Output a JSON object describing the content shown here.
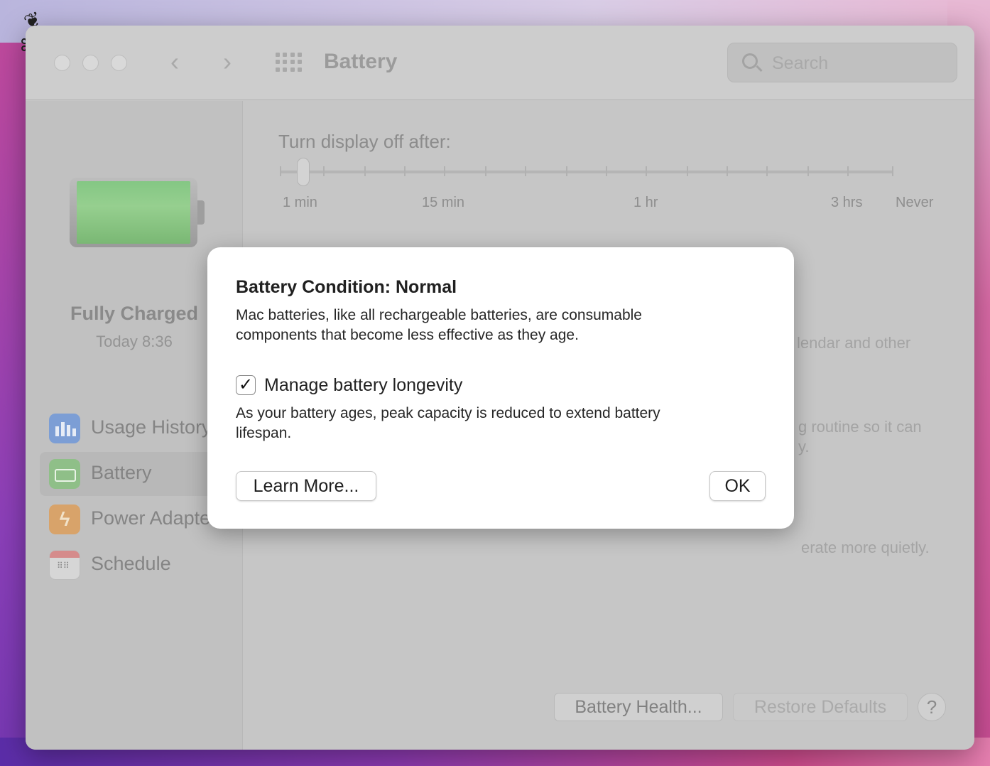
{
  "window": {
    "title": "Battery",
    "search_placeholder": "Search"
  },
  "sidebar": {
    "status": "Fully Charged",
    "time": "Today 8:36",
    "items": [
      {
        "label": "Usage History",
        "icon": "usage-history-icon"
      },
      {
        "label": "Battery",
        "icon": "battery-icon",
        "selected": true
      },
      {
        "label": "Power Adapter",
        "icon": "power-adapter-icon"
      },
      {
        "label": "Schedule",
        "icon": "schedule-icon"
      }
    ]
  },
  "content": {
    "slider_label": "Turn display off after:",
    "slider_ticks": [
      "1 min",
      "15 min",
      "1 hr",
      "3 hrs",
      "Never"
    ],
    "slider_value": "1 min",
    "fragment_1": "lendar and other",
    "fragment_2": "g routine so it can",
    "fragment_3": "y.",
    "fragment_4": "erate more quietly."
  },
  "footer": {
    "battery_health": "Battery Health...",
    "restore_defaults": "Restore Defaults",
    "help": "?"
  },
  "dialog": {
    "title": "Battery Condition: Normal",
    "body": "Mac batteries, like all rechargeable batteries, are consumable components that become less effective as they age.",
    "checkbox_label": "Manage battery longevity",
    "checkbox_checked": true,
    "subtext": "As your battery ages, peak capacity is reduced to extend battery lifespan.",
    "learn_more": "Learn More...",
    "ok": "OK"
  }
}
